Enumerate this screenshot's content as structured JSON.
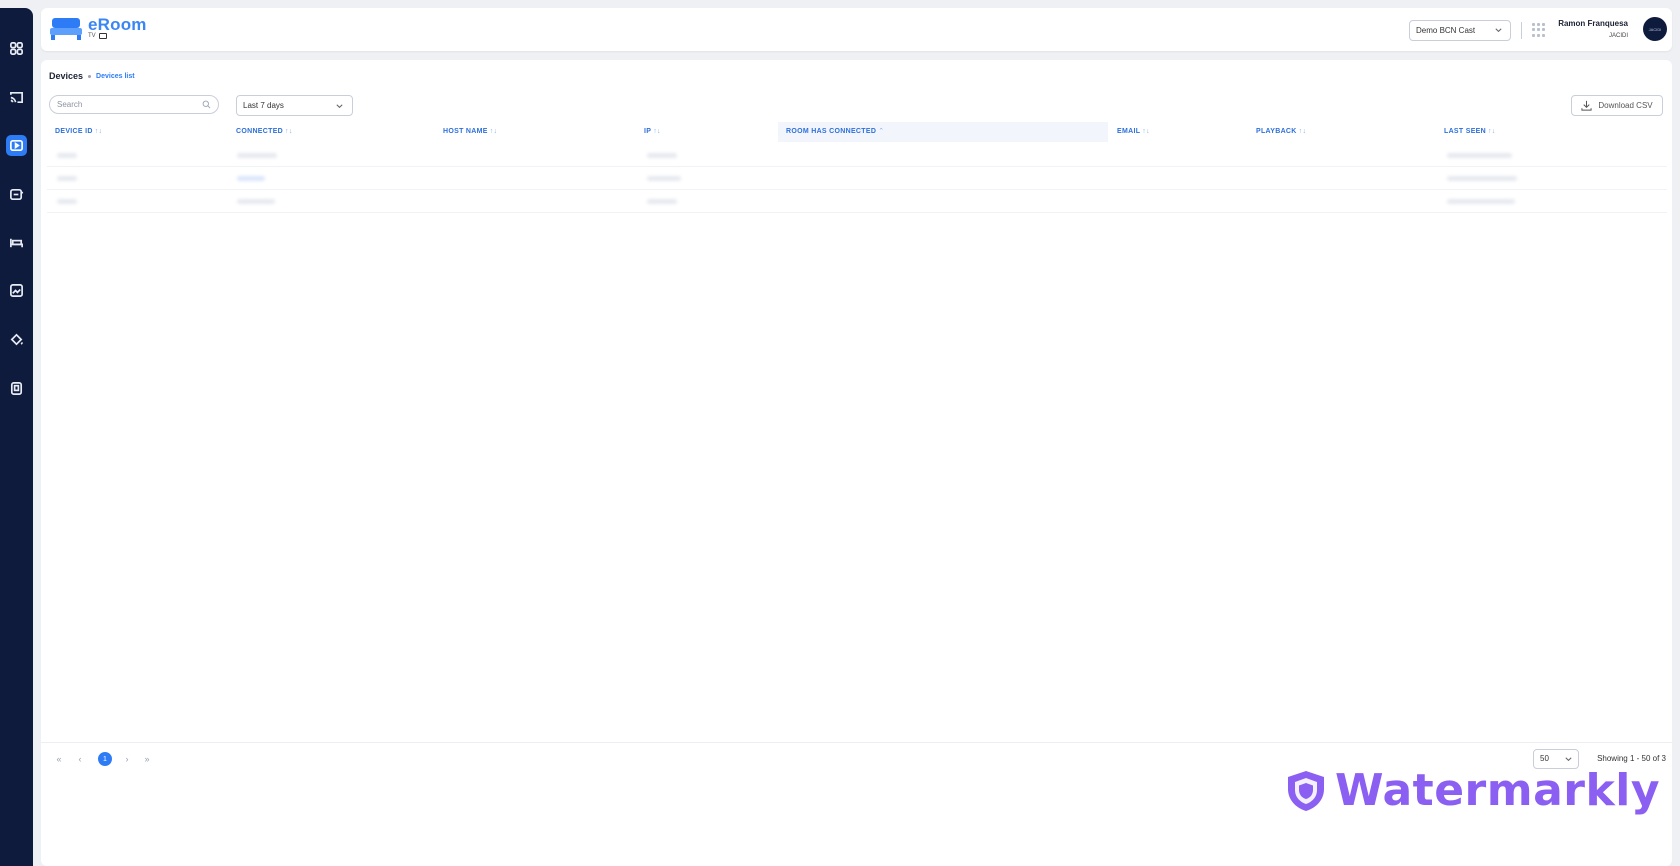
{
  "app": {
    "name": "eRoom",
    "sub": "TV"
  },
  "sidebar": {
    "items": [
      {
        "icon": "dashboard-icon"
      },
      {
        "icon": "cast-icon"
      },
      {
        "icon": "devices-icon",
        "active": true
      },
      {
        "icon": "content-icon"
      },
      {
        "icon": "rooms-icon"
      },
      {
        "icon": "media-icon"
      },
      {
        "icon": "theme-icon"
      },
      {
        "icon": "account-icon"
      }
    ]
  },
  "header": {
    "org_select": "Demo BCN Cast",
    "user_name": "Ramon Franquesa",
    "user_org": "JACIDI",
    "avatar_text": "JACIDI"
  },
  "page": {
    "title": "Devices",
    "breadcrumb": "Devices list",
    "search_placeholder": "Search",
    "date_range": "Last 7 days",
    "download_label": "Download CSV"
  },
  "table": {
    "columns": [
      {
        "label": "DEVICE ID",
        "sort": "↑↓"
      },
      {
        "label": "CONNECTED",
        "sort": "↑↓"
      },
      {
        "label": "HOST NAME",
        "sort": "↑↓"
      },
      {
        "label": "IP",
        "sort": "↑↓"
      },
      {
        "label": "ROOM HAS CONNECTED",
        "sort": "⌃"
      },
      {
        "label": "EMAIL",
        "sort": "↑↓"
      },
      {
        "label": "PLAYBACK",
        "sort": "↑↓"
      },
      {
        "label": "LAST SEEN",
        "sort": "↑↓"
      }
    ]
  },
  "pagination": {
    "first": "«",
    "prev": "‹",
    "current": "1",
    "next": "›",
    "last": "»",
    "per_page": "50",
    "showing": "Showing 1 - 50 of 3"
  },
  "watermark": {
    "text": "Watermarkly"
  }
}
